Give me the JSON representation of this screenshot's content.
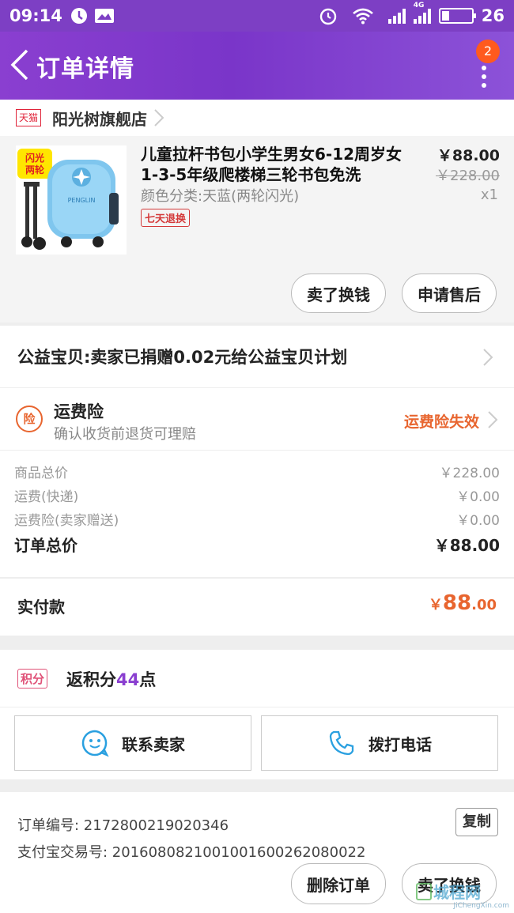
{
  "status_bar": {
    "time": "09:14",
    "network": "4G",
    "battery": "26",
    "battery_level": 0.26
  },
  "nav": {
    "title": "订单详情",
    "badge": "2"
  },
  "shop": {
    "platform_tag": "天猫",
    "name": "阳光树旗舰店"
  },
  "product": {
    "image_badge": "闪光两轮",
    "image_brand": "PENGLIN",
    "title": "儿童拉杆书包小学生男女6-12周岁女1-3-5年级爬楼梯三轮书包免洗",
    "sku": "颜色分类:天蓝(两轮闪光)",
    "tag": "七天退换",
    "price": "￥88.00",
    "original_price": "￥228.00",
    "quantity": "x1",
    "buttons": {
      "resell": "卖了换钱",
      "after_sale": "申请售后"
    }
  },
  "charity": {
    "text": "公益宝贝:卖家已捐赠0.02元给公益宝贝计划"
  },
  "shipping_insurance": {
    "icon_label": "险",
    "title": "运费险",
    "subtitle": "确认收货前退货可理赔",
    "status": "运费险失效"
  },
  "summary": {
    "lines": [
      {
        "label": "商品总价",
        "value": "￥228.00"
      },
      {
        "label": "运费(快递)",
        "value": "￥0.00"
      },
      {
        "label": "运费险(卖家赠送)",
        "value": "￥0.00"
      }
    ],
    "total_label": "订单总价",
    "total_value": "￥88.00"
  },
  "payment": {
    "label": "实付款",
    "currency": "￥",
    "integer": "88",
    "decimal": ".00"
  },
  "points": {
    "tag": "积分",
    "prefix": "返积分",
    "number": "44",
    "suffix": "点"
  },
  "contact": {
    "seller": "联系卖家",
    "call": "拨打电话"
  },
  "order_info": {
    "order_no": "订单编号: 2172800219020346",
    "alipay_no": "支付宝交易号: 2016080821001001600262080022",
    "copy_label": "复制"
  },
  "bottom_actions": {
    "delete": "删除订单",
    "resell": "卖了换钱"
  },
  "watermark": {
    "big": "城程网",
    "small": "JiChengXin.com"
  },
  "colors": {
    "nav_purple": "#7d3fc4",
    "accent_orange": "#e8652f",
    "badge_red": "#ff5a1e",
    "points_purple": "#8a3fd0"
  }
}
